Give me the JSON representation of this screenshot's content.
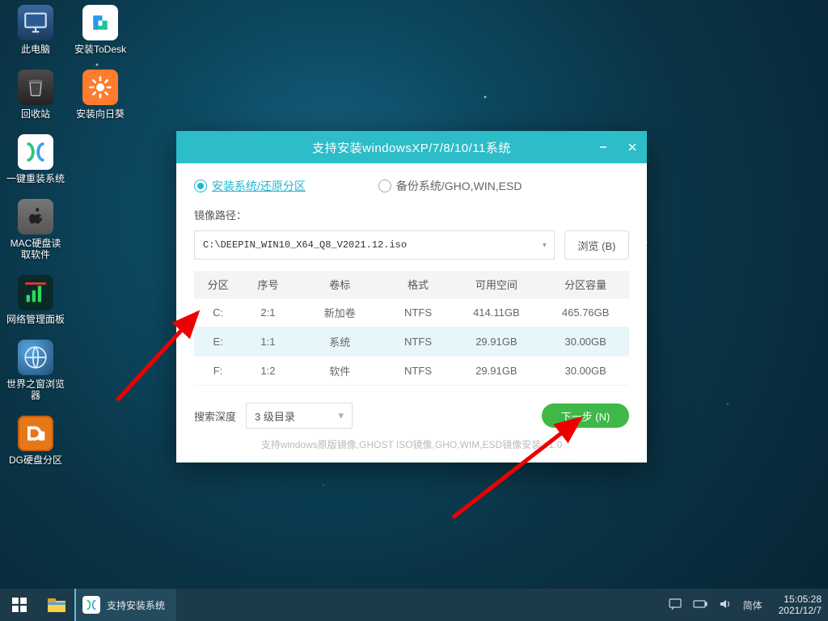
{
  "desktop_icons_col1": [
    {
      "label": "此电脑",
      "kind": "monitor"
    },
    {
      "label": "回收站",
      "kind": "trash"
    },
    {
      "label": "一键重装系统",
      "kind": "reinstall"
    },
    {
      "label": "MAC硬盘读取软件",
      "kind": "macread"
    },
    {
      "label": "网络管理面板",
      "kind": "netpanel"
    },
    {
      "label": "世界之窗浏览器",
      "kind": "globe"
    },
    {
      "label": "DG硬盘分区",
      "kind": "dg"
    }
  ],
  "desktop_icons_col2": [
    {
      "label": "安装ToDesk",
      "kind": "todesk"
    },
    {
      "label": "安装向日葵",
      "kind": "sun"
    }
  ],
  "dialog": {
    "title": "支持安装windowsXP/7/8/10/11系统",
    "radio_install": "安装系统/还原分区",
    "radio_backup": "备份系统/GHO,WIN,ESD",
    "mirror_label": "镜像路径：",
    "path": "C:\\DEEPIN_WIN10_X64_Q8_V2021.12.iso",
    "browse": "浏览 (B)",
    "headers": [
      "分区",
      "序号",
      "卷标",
      "格式",
      "可用空间",
      "分区容量"
    ],
    "rows": [
      {
        "p": "C:",
        "n": "2:1",
        "v": "新加卷",
        "f": "NTFS",
        "free": "414.11GB",
        "cap": "465.76GB"
      },
      {
        "p": "E:",
        "n": "1:1",
        "v": "系统",
        "f": "NTFS",
        "free": "29.91GB",
        "cap": "30.00GB"
      },
      {
        "p": "F:",
        "n": "1:2",
        "v": "软件",
        "f": "NTFS",
        "free": "29.91GB",
        "cap": "30.00GB"
      }
    ],
    "depth_label": "搜索深度",
    "depth_value": "3 级目录",
    "next": "下一步 (N)",
    "footnote": "支持windows原版镜像,GHOST ISO镜像,GHO,WIM,ESD镜像安装 v1.0"
  },
  "taskbar": {
    "app": "支持安装系统",
    "ime": "简体",
    "time": "15:05:28",
    "date": "2021/12/7"
  }
}
